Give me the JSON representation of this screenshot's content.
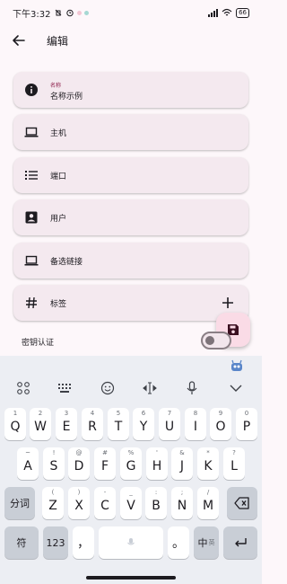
{
  "status": {
    "time": "下午3:32",
    "battery": "66"
  },
  "appbar": {
    "title": "编辑"
  },
  "fields": {
    "name": {
      "label": "名称",
      "value": "名称示例"
    },
    "host": {
      "label": "主机"
    },
    "port": {
      "label": "端口"
    },
    "user": {
      "label": "用户"
    },
    "alt": {
      "label": "备选链接"
    },
    "tags": {
      "label": "标签"
    }
  },
  "key_auth": {
    "label": "密钥认证",
    "enabled": false
  },
  "keyboard": {
    "row1": [
      {
        "sup": "1",
        "key": "Q"
      },
      {
        "sup": "2",
        "key": "W"
      },
      {
        "sup": "3",
        "key": "E"
      },
      {
        "sup": "4",
        "key": "R"
      },
      {
        "sup": "5",
        "key": "T"
      },
      {
        "sup": "6",
        "key": "Y"
      },
      {
        "sup": "7",
        "key": "U"
      },
      {
        "sup": "8",
        "key": "I"
      },
      {
        "sup": "9",
        "key": "O"
      },
      {
        "sup": "0",
        "key": "P"
      }
    ],
    "row2": [
      {
        "sup": "~",
        "key": "A"
      },
      {
        "sup": "!",
        "key": "S"
      },
      {
        "sup": "@",
        "key": "D"
      },
      {
        "sup": "#",
        "key": "F"
      },
      {
        "sup": "%",
        "key": "G"
      },
      {
        "sup": "'",
        "key": "H"
      },
      {
        "sup": "&",
        "key": "J"
      },
      {
        "sup": "*",
        "key": "K"
      },
      {
        "sup": "?",
        "key": "L"
      }
    ],
    "row3": [
      {
        "sup": "(",
        "key": "Z"
      },
      {
        "sup": ")",
        "key": "X"
      },
      {
        "sup": "-",
        "key": "C"
      },
      {
        "sup": "_",
        "key": "V"
      },
      {
        "sup": ":",
        "key": "B"
      },
      {
        "sup": ";",
        "key": "N"
      },
      {
        "sup": "/",
        "key": "M"
      }
    ],
    "segment_label": "分词",
    "symbol_label": "符",
    "num_label": "123",
    "comma": "，",
    "period": "。",
    "lang_label": "中",
    "lang_sub": "英"
  }
}
